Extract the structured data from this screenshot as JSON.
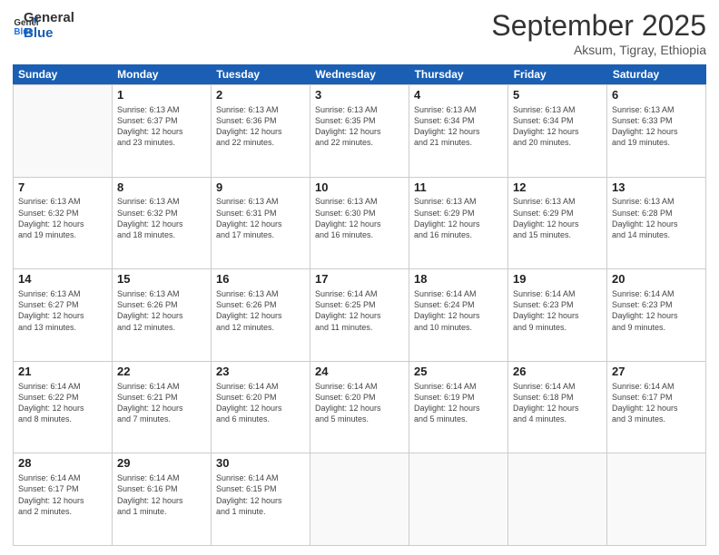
{
  "logo": {
    "line1": "General",
    "line2": "Blue"
  },
  "header": {
    "month": "September 2025",
    "location": "Aksum, Tigray, Ethiopia"
  },
  "weekdays": [
    "Sunday",
    "Monday",
    "Tuesday",
    "Wednesday",
    "Thursday",
    "Friday",
    "Saturday"
  ],
  "weeks": [
    [
      {
        "day": null
      },
      {
        "day": 1,
        "sunrise": "6:13 AM",
        "sunset": "6:37 PM",
        "daylight": "12 hours and 23 minutes."
      },
      {
        "day": 2,
        "sunrise": "6:13 AM",
        "sunset": "6:36 PM",
        "daylight": "12 hours and 22 minutes."
      },
      {
        "day": 3,
        "sunrise": "6:13 AM",
        "sunset": "6:35 PM",
        "daylight": "12 hours and 22 minutes."
      },
      {
        "day": 4,
        "sunrise": "6:13 AM",
        "sunset": "6:34 PM",
        "daylight": "12 hours and 21 minutes."
      },
      {
        "day": 5,
        "sunrise": "6:13 AM",
        "sunset": "6:34 PM",
        "daylight": "12 hours and 20 minutes."
      },
      {
        "day": 6,
        "sunrise": "6:13 AM",
        "sunset": "6:33 PM",
        "daylight": "12 hours and 19 minutes."
      }
    ],
    [
      {
        "day": 7,
        "sunrise": "6:13 AM",
        "sunset": "6:32 PM",
        "daylight": "12 hours and 19 minutes."
      },
      {
        "day": 8,
        "sunrise": "6:13 AM",
        "sunset": "6:32 PM",
        "daylight": "12 hours and 18 minutes."
      },
      {
        "day": 9,
        "sunrise": "6:13 AM",
        "sunset": "6:31 PM",
        "daylight": "12 hours and 17 minutes."
      },
      {
        "day": 10,
        "sunrise": "6:13 AM",
        "sunset": "6:30 PM",
        "daylight": "12 hours and 16 minutes."
      },
      {
        "day": 11,
        "sunrise": "6:13 AM",
        "sunset": "6:29 PM",
        "daylight": "12 hours and 16 minutes."
      },
      {
        "day": 12,
        "sunrise": "6:13 AM",
        "sunset": "6:29 PM",
        "daylight": "12 hours and 15 minutes."
      },
      {
        "day": 13,
        "sunrise": "6:13 AM",
        "sunset": "6:28 PM",
        "daylight": "12 hours and 14 minutes."
      }
    ],
    [
      {
        "day": 14,
        "sunrise": "6:13 AM",
        "sunset": "6:27 PM",
        "daylight": "12 hours and 13 minutes."
      },
      {
        "day": 15,
        "sunrise": "6:13 AM",
        "sunset": "6:26 PM",
        "daylight": "12 hours and 12 minutes."
      },
      {
        "day": 16,
        "sunrise": "6:13 AM",
        "sunset": "6:26 PM",
        "daylight": "12 hours and 12 minutes."
      },
      {
        "day": 17,
        "sunrise": "6:14 AM",
        "sunset": "6:25 PM",
        "daylight": "12 hours and 11 minutes."
      },
      {
        "day": 18,
        "sunrise": "6:14 AM",
        "sunset": "6:24 PM",
        "daylight": "12 hours and 10 minutes."
      },
      {
        "day": 19,
        "sunrise": "6:14 AM",
        "sunset": "6:23 PM",
        "daylight": "12 hours and 9 minutes."
      },
      {
        "day": 20,
        "sunrise": "6:14 AM",
        "sunset": "6:23 PM",
        "daylight": "12 hours and 9 minutes."
      }
    ],
    [
      {
        "day": 21,
        "sunrise": "6:14 AM",
        "sunset": "6:22 PM",
        "daylight": "12 hours and 8 minutes."
      },
      {
        "day": 22,
        "sunrise": "6:14 AM",
        "sunset": "6:21 PM",
        "daylight": "12 hours and 7 minutes."
      },
      {
        "day": 23,
        "sunrise": "6:14 AM",
        "sunset": "6:20 PM",
        "daylight": "12 hours and 6 minutes."
      },
      {
        "day": 24,
        "sunrise": "6:14 AM",
        "sunset": "6:20 PM",
        "daylight": "12 hours and 5 minutes."
      },
      {
        "day": 25,
        "sunrise": "6:14 AM",
        "sunset": "6:19 PM",
        "daylight": "12 hours and 5 minutes."
      },
      {
        "day": 26,
        "sunrise": "6:14 AM",
        "sunset": "6:18 PM",
        "daylight": "12 hours and 4 minutes."
      },
      {
        "day": 27,
        "sunrise": "6:14 AM",
        "sunset": "6:17 PM",
        "daylight": "12 hours and 3 minutes."
      }
    ],
    [
      {
        "day": 28,
        "sunrise": "6:14 AM",
        "sunset": "6:17 PM",
        "daylight": "12 hours and 2 minutes."
      },
      {
        "day": 29,
        "sunrise": "6:14 AM",
        "sunset": "6:16 PM",
        "daylight": "12 hours and 1 minute."
      },
      {
        "day": 30,
        "sunrise": "6:14 AM",
        "sunset": "6:15 PM",
        "daylight": "12 hours and 1 minute."
      },
      {
        "day": null
      },
      {
        "day": null
      },
      {
        "day": null
      },
      {
        "day": null
      }
    ]
  ],
  "labels": {
    "sunrise": "Sunrise:",
    "sunset": "Sunset:",
    "daylight": "Daylight:"
  }
}
